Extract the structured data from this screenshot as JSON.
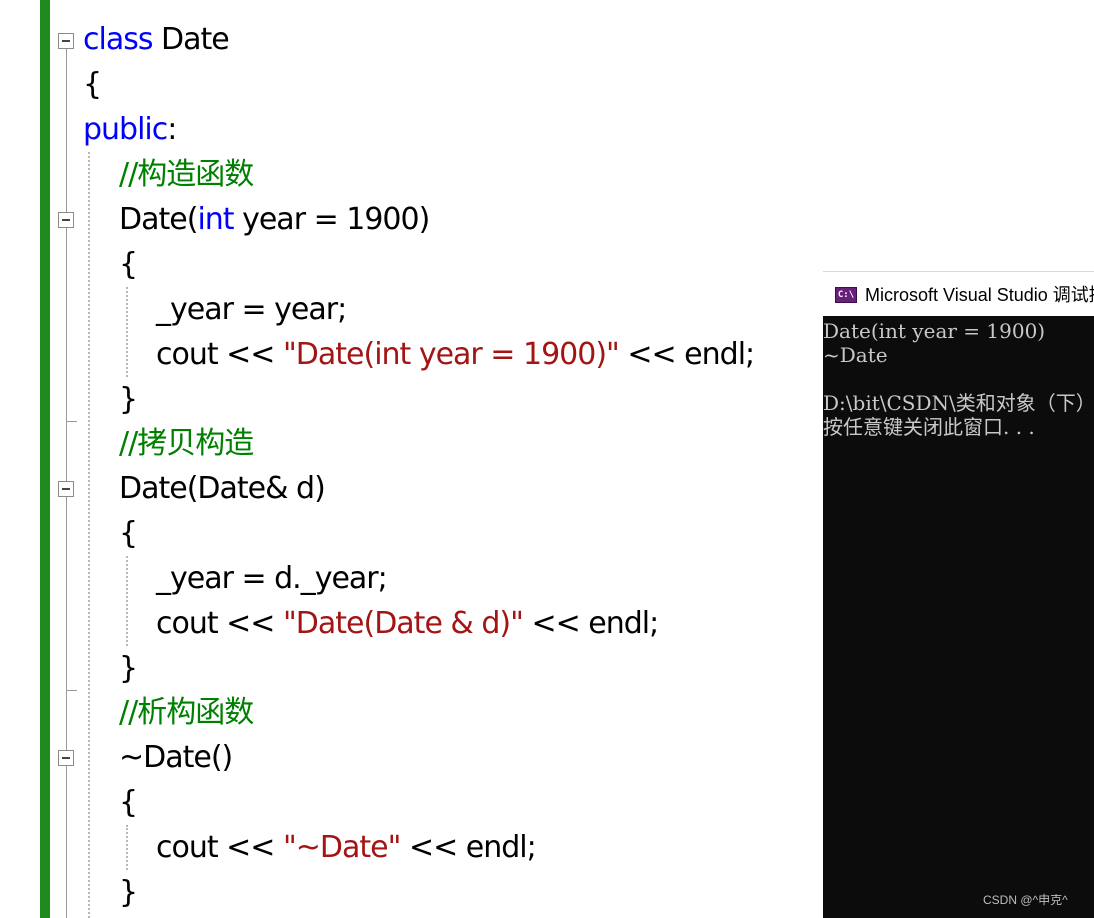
{
  "editor": {
    "lines": [
      {
        "parts": [
          {
            "t": "class",
            "c": "kw"
          },
          {
            "t": " Date",
            "c": ""
          }
        ]
      },
      {
        "parts": [
          {
            "t": "{",
            "c": ""
          }
        ]
      },
      {
        "parts": [
          {
            "t": "public",
            "c": "kw"
          },
          {
            "t": ":",
            "c": ""
          }
        ]
      },
      {
        "parts": [
          {
            "t": "//构造函数",
            "c": "cm"
          }
        ]
      },
      {
        "parts": [
          {
            "t": "Date",
            "c": "",
            "squiggle": true
          },
          {
            "t": "(",
            "c": ""
          },
          {
            "t": "int",
            "c": "kw"
          },
          {
            "t": " year = 1900)",
            "c": ""
          }
        ]
      },
      {
        "parts": [
          {
            "t": "{",
            "c": ""
          }
        ]
      },
      {
        "parts": [
          {
            "t": "_year = year;",
            "c": ""
          }
        ]
      },
      {
        "parts": [
          {
            "t": "cout << ",
            "c": ""
          },
          {
            "t": "\"Date(int year = 1900)\"",
            "c": "str"
          },
          {
            "t": " << endl;",
            "c": ""
          }
        ]
      },
      {
        "parts": [
          {
            "t": "}",
            "c": ""
          }
        ]
      },
      {
        "parts": [
          {
            "t": "//拷贝构造",
            "c": "cm"
          }
        ]
      },
      {
        "parts": [
          {
            "t": "Date",
            "c": "",
            "squiggle": true
          },
          {
            "t": "(Date& d)",
            "c": ""
          }
        ]
      },
      {
        "parts": [
          {
            "t": "{",
            "c": ""
          }
        ]
      },
      {
        "parts": [
          {
            "t": "_year = d._year;",
            "c": ""
          }
        ]
      },
      {
        "parts": [
          {
            "t": "cout << ",
            "c": ""
          },
          {
            "t": "\"Date(Date & d)\"",
            "c": "str"
          },
          {
            "t": " << endl;",
            "c": ""
          }
        ]
      },
      {
        "parts": [
          {
            "t": "}",
            "c": ""
          }
        ]
      },
      {
        "parts": [
          {
            "t": "//析构函数",
            "c": "cm"
          }
        ]
      },
      {
        "parts": [
          {
            "t": "~Date()",
            "c": ""
          }
        ]
      },
      {
        "parts": [
          {
            "t": "{",
            "c": ""
          }
        ]
      },
      {
        "parts": [
          {
            "t": "cout << ",
            "c": "",
            "squiggle": true
          },
          {
            "t": "\"~Date\"",
            "c": "str",
            "squiggle": true
          },
          {
            "t": " << endl;",
            "c": "",
            "squiggle": true
          }
        ]
      },
      {
        "parts": [
          {
            "t": "}",
            "c": ""
          }
        ]
      }
    ]
  },
  "console": {
    "title": "Microsoft Visual Studio 调试控制台",
    "icon": "console-app-icon",
    "icon_label": "C:\\",
    "lines": [
      "Date(int year = 1900)",
      "~Date",
      "",
      "D:\\bit\\CSDN\\类和对象（下）",
      "按任意键关闭此窗口. . ."
    ]
  },
  "watermark": "CSDN @^申克^",
  "colors": {
    "keyword": "#0000ff",
    "comment": "#008000",
    "string": "#a31515",
    "change_bar": "#1f8a1f",
    "console_bg": "#0c0c0c",
    "console_text": "#c8c8c8"
  }
}
